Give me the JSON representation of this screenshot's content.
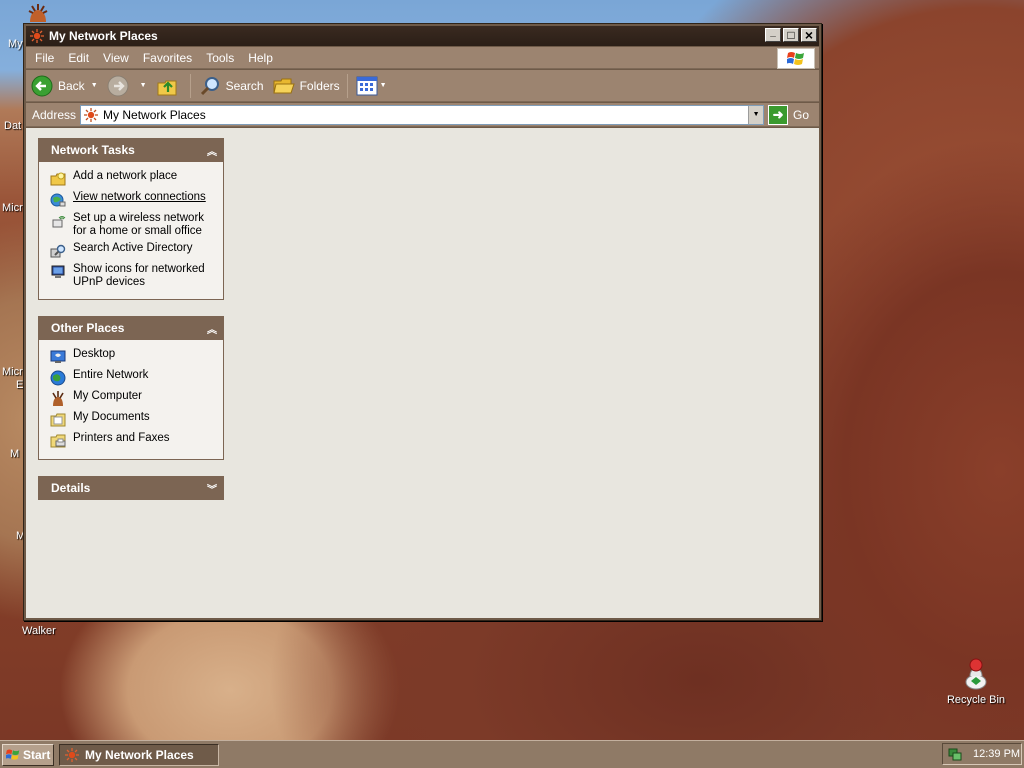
{
  "window": {
    "title": "My Network Places",
    "minimize_glyph": "_",
    "maximize_glyph": "□",
    "close_glyph": "×"
  },
  "menu": [
    "File",
    "Edit",
    "View",
    "Favorites",
    "Tools",
    "Help"
  ],
  "toolbar": {
    "back_label": "Back",
    "search_label": "Search",
    "folders_label": "Folders"
  },
  "address": {
    "label": "Address",
    "value": "My Network Places",
    "go_label": "Go"
  },
  "network_tasks": {
    "title": "Network Tasks",
    "items": [
      {
        "label": "Add a network place",
        "icon": "add-network-place-icon"
      },
      {
        "label": "View network connections",
        "icon": "network-connections-icon"
      },
      {
        "label": "Set up a wireless network for a home or small office",
        "icon": "wireless-network-icon"
      },
      {
        "label": "Search Active Directory",
        "icon": "search-directory-icon"
      },
      {
        "label": "Show icons for networked UPnP devices",
        "icon": "upnp-devices-icon"
      }
    ]
  },
  "other_places": {
    "title": "Other Places",
    "items": [
      {
        "label": "Desktop",
        "icon": "desktop-icon"
      },
      {
        "label": "Entire Network",
        "icon": "entire-network-icon"
      },
      {
        "label": "My Computer",
        "icon": "my-computer-icon"
      },
      {
        "label": "My Documents",
        "icon": "my-documents-icon"
      },
      {
        "label": "Printers and Faxes",
        "icon": "printers-faxes-icon"
      }
    ]
  },
  "details": {
    "title": "Details"
  },
  "desktop": {
    "left_labels": [
      "My",
      "Dat",
      "Micr",
      "Micr",
      "E",
      "M",
      "M"
    ],
    "walker_label": "Walker",
    "recycle_bin_label": "Recycle Bin"
  },
  "taskbar": {
    "start_label": "Start",
    "task_label": "My Network Places",
    "clock": "12:39 PM"
  },
  "colors": {
    "title_bar": "#2b1f17",
    "toolbar": "#9c8470",
    "panel_header": "#7c6553",
    "content_bg": "#e8e6df"
  }
}
